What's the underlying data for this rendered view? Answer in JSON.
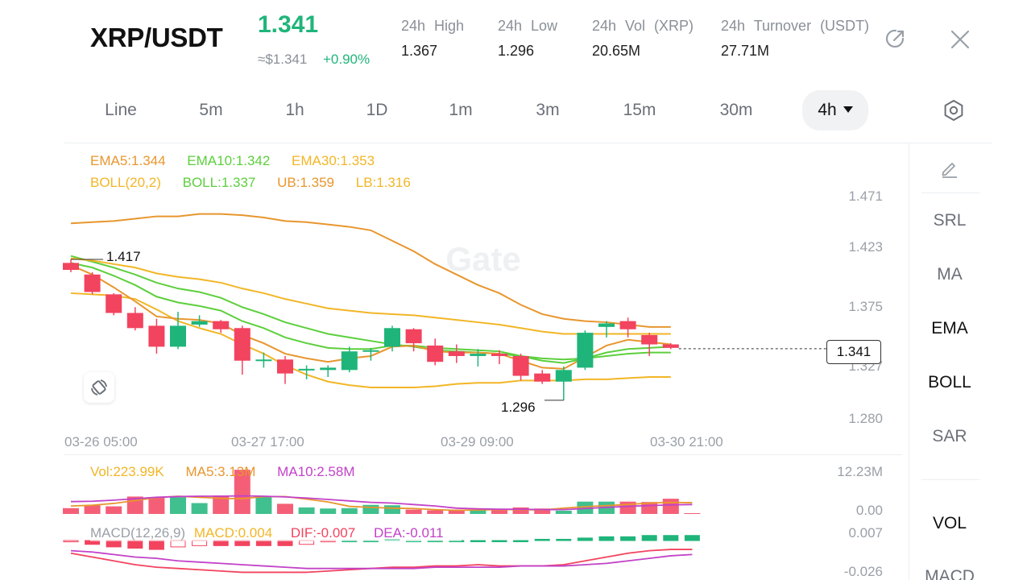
{
  "header": {
    "pair": "XRP/USDT",
    "price": "1.341",
    "usd_price": "≈$1.341",
    "change": "+0.90%",
    "stats": [
      {
        "label": "24h High",
        "value": "1.367"
      },
      {
        "label": "24h Low",
        "value": "1.296"
      },
      {
        "label": "24h Vol (XRP)",
        "value": "20.65M"
      },
      {
        "label": "24h Turnover (USDT)",
        "value": "27.71M"
      }
    ]
  },
  "icons": {
    "share": "share-icon",
    "close": "close-icon",
    "settings": "settings-icon",
    "pencil": "pencil-icon",
    "rotate": "rotate-icon"
  },
  "tabs": [
    "Line",
    "5m",
    "1h",
    "1D",
    "1m",
    "3m",
    "15m",
    "30m",
    "4h"
  ],
  "active_tab": "4h",
  "indicators": {
    "ema5": "EMA5:1.344",
    "ema10": "EMA10:1.342",
    "ema30": "EMA30:1.353",
    "boll": "BOLL(20,2)",
    "boll_mid": "BOLL:1.337",
    "ub": "UB:1.359",
    "lb": "LB:1.316"
  },
  "watermark": "Gate",
  "main_y_ticks": [
    "1.471",
    "1.423",
    "1.375",
    "1.327",
    "1.280"
  ],
  "x_ticks": [
    "03-26 05:00",
    "03-27 17:00",
    "03-29 09:00",
    "03-30 21:00"
  ],
  "annotations": {
    "high": "1.417",
    "low": "1.296",
    "current": "1.341"
  },
  "volume": {
    "vol": "Vol:223.99K",
    "ma5": "MA5:3.13M",
    "ma10": "MA10:2.58M",
    "y_top": "12.23M",
    "y_bottom": "0.00"
  },
  "macd": {
    "params": "MACD(12,26,9)",
    "macd": "MACD:0.004",
    "dif": "DIF:-0.007",
    "dea": "DEA:-0.011",
    "y_top": "0.007",
    "y_bottom": "-0.026"
  },
  "side_menu": [
    "SRL",
    "MA",
    "EMA",
    "BOLL",
    "SAR",
    "VOL",
    "MACD"
  ],
  "side_menu_active": [
    "EMA",
    "BOLL",
    "VOL"
  ],
  "colors": {
    "up": "#1fb57a",
    "down": "#f2435f",
    "ema5": "#e8962e",
    "ema10": "#5ccf3c",
    "ema30": "#f2b626",
    "vol_ma10": "#c242c8"
  },
  "chart_data": {
    "type": "candlestick",
    "y_range": [
      1.28,
      1.471
    ],
    "candles": [
      {
        "o": 1.414,
        "h": 1.417,
        "l": 1.406,
        "c": 1.408
      },
      {
        "o": 1.404,
        "h": 1.406,
        "l": 1.387,
        "c": 1.389
      },
      {
        "o": 1.387,
        "h": 1.388,
        "l": 1.369,
        "c": 1.371
      },
      {
        "o": 1.371,
        "h": 1.376,
        "l": 1.356,
        "c": 1.358
      },
      {
        "o": 1.36,
        "h": 1.366,
        "l": 1.336,
        "c": 1.342
      },
      {
        "o": 1.342,
        "h": 1.372,
        "l": 1.34,
        "c": 1.36
      },
      {
        "o": 1.361,
        "h": 1.369,
        "l": 1.359,
        "c": 1.364
      },
      {
        "o": 1.364,
        "h": 1.365,
        "l": 1.354,
        "c": 1.357
      },
      {
        "o": 1.358,
        "h": 1.36,
        "l": 1.318,
        "c": 1.33
      },
      {
        "o": 1.33,
        "h": 1.337,
        "l": 1.324,
        "c": 1.331
      },
      {
        "o": 1.331,
        "h": 1.334,
        "l": 1.31,
        "c": 1.319
      },
      {
        "o": 1.322,
        "h": 1.326,
        "l": 1.314,
        "c": 1.323
      },
      {
        "o": 1.322,
        "h": 1.326,
        "l": 1.316,
        "c": 1.324
      },
      {
        "o": 1.322,
        "h": 1.342,
        "l": 1.32,
        "c": 1.338
      },
      {
        "o": 1.338,
        "h": 1.341,
        "l": 1.33,
        "c": 1.339
      },
      {
        "o": 1.342,
        "h": 1.36,
        "l": 1.338,
        "c": 1.358
      },
      {
        "o": 1.357,
        "h": 1.358,
        "l": 1.338,
        "c": 1.345
      },
      {
        "o": 1.343,
        "h": 1.349,
        "l": 1.326,
        "c": 1.329
      },
      {
        "o": 1.338,
        "h": 1.344,
        "l": 1.328,
        "c": 1.334
      },
      {
        "o": 1.334,
        "h": 1.34,
        "l": 1.325,
        "c": 1.336
      },
      {
        "o": 1.336,
        "h": 1.339,
        "l": 1.327,
        "c": 1.334
      },
      {
        "o": 1.334,
        "h": 1.336,
        "l": 1.313,
        "c": 1.317
      },
      {
        "o": 1.319,
        "h": 1.322,
        "l": 1.31,
        "c": 1.312
      },
      {
        "o": 1.312,
        "h": 1.325,
        "l": 1.296,
        "c": 1.322
      },
      {
        "o": 1.324,
        "h": 1.356,
        "l": 1.322,
        "c": 1.354
      },
      {
        "o": 1.359,
        "h": 1.364,
        "l": 1.35,
        "c": 1.362
      },
      {
        "o": 1.364,
        "h": 1.367,
        "l": 1.35,
        "c": 1.357
      },
      {
        "o": 1.352,
        "h": 1.354,
        "l": 1.334,
        "c": 1.344
      },
      {
        "o": 1.344,
        "h": 1.345,
        "l": 1.34,
        "c": 1.341
      }
    ],
    "ema5": [
      1.412,
      1.404,
      1.393,
      1.381,
      1.368,
      1.366,
      1.365,
      1.362,
      1.352,
      1.345,
      1.336,
      1.332,
      1.329,
      1.332,
      1.334,
      1.342,
      1.343,
      1.338,
      1.337,
      1.337,
      1.336,
      1.33,
      1.324,
      1.323,
      1.333,
      1.343,
      1.348,
      1.346,
      1.344
    ],
    "ema10": [
      1.414,
      1.41,
      1.403,
      1.395,
      1.385,
      1.38,
      1.377,
      1.373,
      1.364,
      1.358,
      1.35,
      1.345,
      1.341,
      1.34,
      1.34,
      1.343,
      1.343,
      1.341,
      1.34,
      1.339,
      1.338,
      1.334,
      1.33,
      1.328,
      1.332,
      1.337,
      1.34,
      1.341,
      1.342
    ],
    "ema30": [
      1.418,
      1.416,
      1.413,
      1.41,
      1.405,
      1.402,
      1.4,
      1.397,
      1.392,
      1.388,
      1.383,
      1.379,
      1.375,
      1.373,
      1.371,
      1.37,
      1.369,
      1.367,
      1.365,
      1.363,
      1.361,
      1.358,
      1.355,
      1.353,
      1.353,
      1.353,
      1.353,
      1.353,
      1.353
    ],
    "boll_ub": [
      1.448,
      1.449,
      1.45,
      1.452,
      1.454,
      1.454,
      1.456,
      1.456,
      1.455,
      1.453,
      1.45,
      1.449,
      1.447,
      1.445,
      1.442,
      1.433,
      1.424,
      1.413,
      1.404,
      1.395,
      1.388,
      1.378,
      1.37,
      1.366,
      1.364,
      1.363,
      1.361,
      1.359,
      1.359
    ],
    "boll_mid": [
      1.42,
      1.415,
      1.41,
      1.404,
      1.397,
      1.392,
      1.389,
      1.384,
      1.376,
      1.37,
      1.363,
      1.358,
      1.353,
      1.35,
      1.347,
      1.344,
      1.342,
      1.339,
      1.338,
      1.337,
      1.336,
      1.334,
      1.332,
      1.331,
      1.332,
      1.334,
      1.336,
      1.337,
      1.337
    ],
    "boll_lb": [
      1.388,
      1.387,
      1.386,
      1.383,
      1.374,
      1.364,
      1.358,
      1.353,
      1.344,
      1.336,
      1.326,
      1.318,
      1.312,
      1.309,
      1.307,
      1.307,
      1.307,
      1.308,
      1.31,
      1.311,
      1.311,
      1.313,
      1.313,
      1.313,
      1.314,
      1.314,
      1.315,
      1.316,
      1.316
    ],
    "volume_y_range": [
      0,
      12.23
    ],
    "volume": [
      1.6,
      2.4,
      2.1,
      4.8,
      4.6,
      4.6,
      3.0,
      5.1,
      12.2,
      4.7,
      2.8,
      1.8,
      1.5,
      1.6,
      2.5,
      2.4,
      1.2,
      1.0,
      1.2,
      1.0,
      1.2,
      1.8,
      1.5,
      0.9,
      3.4,
      3.4,
      3.4,
      3.3,
      4.2,
      0.22
    ],
    "vol_ma5": [
      2.2,
      2.4,
      2.9,
      3.7,
      4.5,
      4.9,
      4.6,
      4.3,
      4.2,
      4.8,
      4.8,
      4.1,
      3.3,
      2.1,
      1.8,
      1.6,
      1.5,
      1.2,
      1.0,
      1.1,
      1.2,
      1.2,
      1.1,
      1.6,
      2.0,
      2.3,
      2.6,
      3.0,
      3.2,
      3.1
    ],
    "vol_ma10": [
      3.4,
      3.5,
      3.8,
      4.2,
      4.6,
      4.8,
      4.9,
      4.9,
      5.0,
      4.9,
      4.7,
      4.4,
      4.0,
      3.6,
      3.2,
      3.0,
      2.6,
      2.2,
      1.6,
      1.4,
      1.3,
      1.3,
      1.2,
      1.2,
      1.5,
      1.8,
      2.1,
      2.3,
      2.5,
      2.6
    ],
    "macd_y_range": [
      -0.026,
      0.007
    ],
    "macd_hist": [
      -0.001,
      -0.003,
      -0.005,
      -0.006,
      -0.007,
      -0.005,
      -0.004,
      -0.004,
      -0.004,
      -0.004,
      -0.004,
      -0.003,
      -0.001,
      0.0,
      0.0,
      0.001,
      0.0,
      0.0,
      0.0,
      0.0,
      0.0,
      0.0,
      0.001,
      0.001,
      0.002,
      0.003,
      0.003,
      0.004,
      0.004,
      0.004
    ],
    "dif": [
      -0.01,
      -0.013,
      -0.016,
      -0.019,
      -0.021,
      -0.022,
      -0.023,
      -0.024,
      -0.025,
      -0.025,
      -0.025,
      -0.025,
      -0.024,
      -0.023,
      -0.022,
      -0.021,
      -0.021,
      -0.02,
      -0.02,
      -0.019,
      -0.02,
      -0.02,
      -0.02,
      -0.019,
      -0.016,
      -0.013,
      -0.01,
      -0.008,
      -0.007,
      -0.007
    ],
    "dea": [
      -0.008,
      -0.009,
      -0.011,
      -0.013,
      -0.014,
      -0.016,
      -0.017,
      -0.018,
      -0.019,
      -0.02,
      -0.021,
      -0.022,
      -0.022,
      -0.022,
      -0.022,
      -0.022,
      -0.022,
      -0.021,
      -0.021,
      -0.021,
      -0.021,
      -0.02,
      -0.02,
      -0.02,
      -0.019,
      -0.018,
      -0.016,
      -0.014,
      -0.012,
      -0.011
    ]
  }
}
